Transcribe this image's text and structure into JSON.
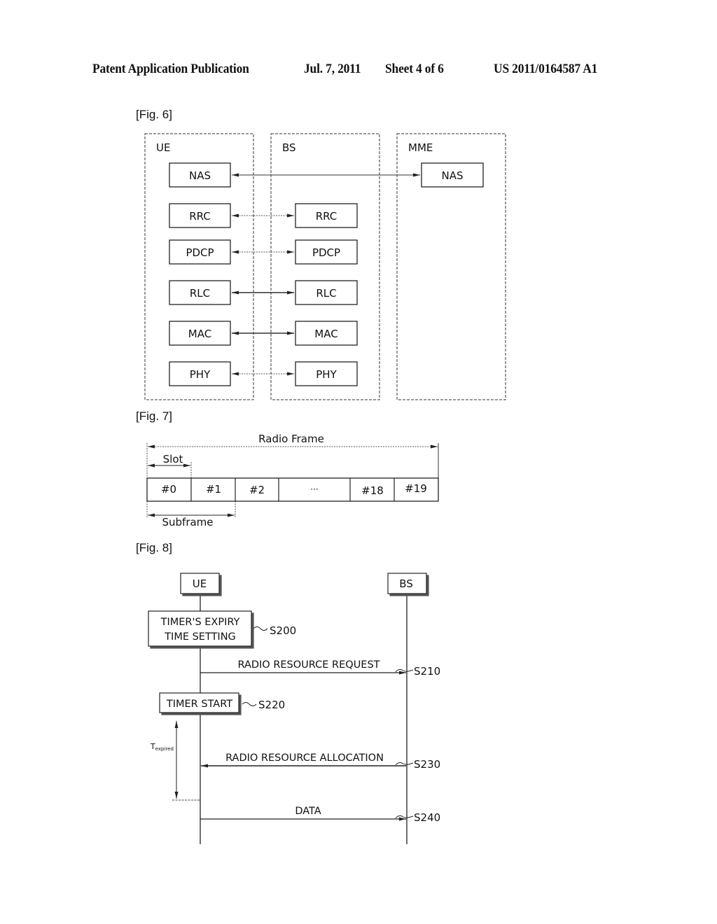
{
  "header": {
    "publication_type": "Patent Application Publication",
    "date": "Jul. 7, 2011",
    "sheet": "Sheet 4 of 6",
    "publication_number": "US 2011/0164587 A1"
  },
  "fig6": {
    "label": "[Fig. 6]",
    "entities": [
      {
        "name": "UE",
        "layers": [
          "NAS",
          "RRC",
          "PDCP",
          "RLC",
          "MAC",
          "PHY"
        ]
      },
      {
        "name": "BS",
        "layers": [
          "RRC",
          "PDCP",
          "RLC",
          "MAC",
          "PHY"
        ]
      },
      {
        "name": "MME",
        "layers": [
          "NAS"
        ]
      }
    ],
    "links": [
      {
        "from": "UE.NAS",
        "to": "MME.NAS",
        "style": "solid"
      },
      {
        "from": "UE.RRC",
        "to": "BS.RRC",
        "style": "dotted"
      },
      {
        "from": "UE.PDCP",
        "to": "BS.PDCP",
        "style": "dotted"
      },
      {
        "from": "UE.RLC",
        "to": "BS.RLC",
        "style": "solid"
      },
      {
        "from": "UE.MAC",
        "to": "BS.MAC",
        "style": "solid"
      },
      {
        "from": "UE.PHY",
        "to": "BS.PHY",
        "style": "dotted"
      }
    ]
  },
  "fig7": {
    "label": "[Fig. 7]",
    "radio_frame_label": "Radio Frame",
    "slot_label": "Slot",
    "subframe_label": "Subframe",
    "cells": [
      "#0",
      "#1",
      "#2",
      "···",
      "#18",
      "#19"
    ]
  },
  "fig8": {
    "label": "[Fig. 8]",
    "actors": [
      "UE",
      "BS"
    ],
    "steps": [
      {
        "id": "S200",
        "type": "process",
        "text_lines": [
          "TIMER'S EXPIRY",
          "TIME SETTING"
        ]
      },
      {
        "id": "S210",
        "type": "message",
        "text": "RADIO RESOURCE REQUEST",
        "direction": "UE->BS"
      },
      {
        "id": "S220",
        "type": "process",
        "text_lines": [
          "TIMER START"
        ]
      },
      {
        "id": "S230",
        "type": "message",
        "text": "RADIO RESOURCE ALLOCATION",
        "direction": "BS->UE"
      },
      {
        "id": "S240",
        "type": "message",
        "text": "DATA",
        "direction": "UE->BS"
      }
    ],
    "timer_label_main": "T",
    "timer_label_sub": "expired"
  }
}
